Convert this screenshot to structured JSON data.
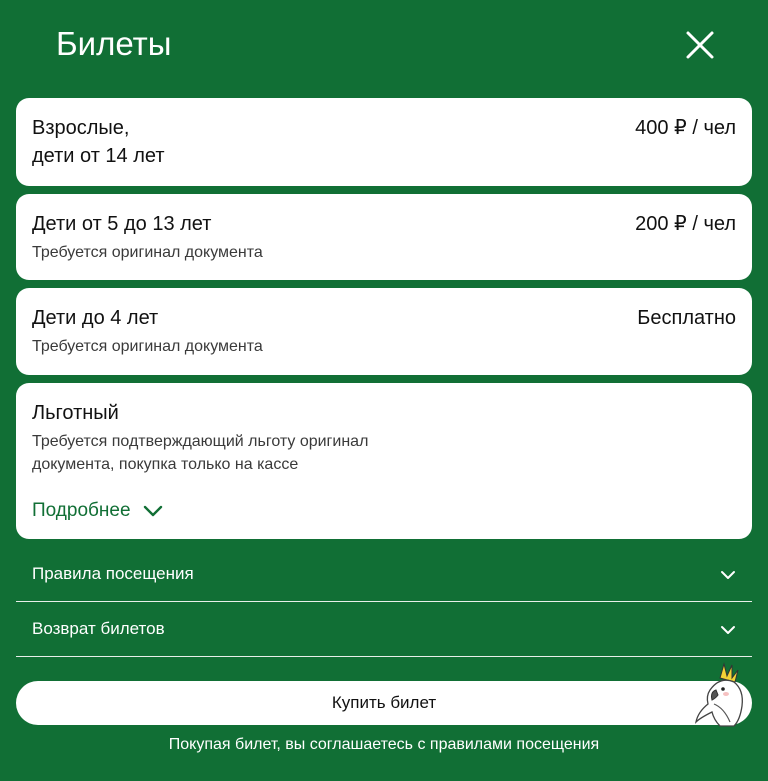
{
  "header": {
    "title": "Билеты",
    "close_icon": "close-icon"
  },
  "tickets": [
    {
      "title_line1": "Взрослые,",
      "title_line2": "дети от 14 лет",
      "price": "400 ₽ / чел"
    },
    {
      "title": "Дети от 5 до 13 лет",
      "price": "200 ₽ / чел",
      "note": "Требуется оригинал документа"
    },
    {
      "title": "Дети до 4 лет",
      "price": "Бесплатно",
      "note": "Требуется оригинал документа"
    },
    {
      "title": "Льготный",
      "note_line1": "Требуется подтверждающий льготу оригинал",
      "note_line2": "документа, покупка только на кассе",
      "more": "Подробнее"
    }
  ],
  "accordion": [
    {
      "label": "Правила посещения"
    },
    {
      "label": "Возврат билетов"
    }
  ],
  "buy_button": "Купить билет",
  "agreement": "Покупая билет, вы соглашаетесь с правилами посещения",
  "colors": {
    "background": "#116f35",
    "accent": "#116f35",
    "card": "#ffffff"
  },
  "icons": {
    "close": "close-icon",
    "chevron": "chevron-down-icon",
    "mascot": "cockatoo-mascot-icon"
  }
}
